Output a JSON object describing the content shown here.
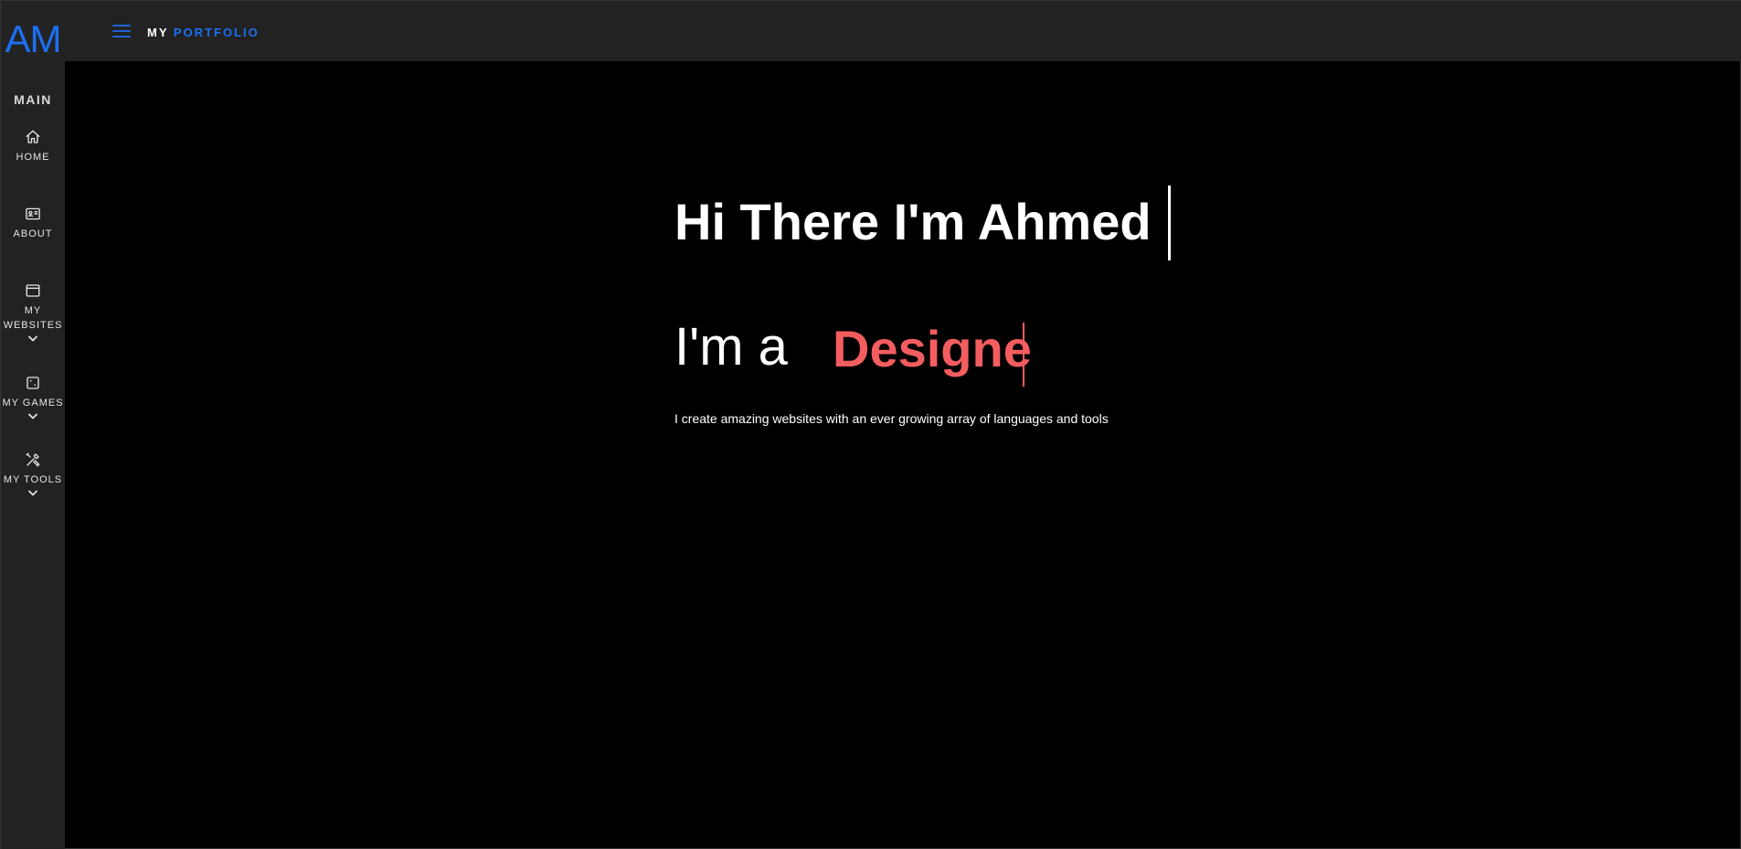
{
  "sidebar": {
    "logo": "AM",
    "section_title": "MAIN",
    "items": [
      {
        "label": "HOME",
        "icon": "home-icon",
        "has_submenu": false
      },
      {
        "label": "ABOUT",
        "icon": "id-card-icon",
        "has_submenu": false
      },
      {
        "label": "MY WEBSITES",
        "icon": "browser-window-icon",
        "has_submenu": true
      },
      {
        "label": "MY GAMES",
        "icon": "dice-icon",
        "has_submenu": true
      },
      {
        "label": "MY TOOLS",
        "icon": "tools-icon",
        "has_submenu": true
      }
    ]
  },
  "header": {
    "menu_icon": "hamburger-menu-icon",
    "brand_prefix": "MY",
    "brand_accent": "PORTFOLIO"
  },
  "hero": {
    "title": "Hi There I'm Ahmed",
    "subtitle_prefix": "I'm a",
    "subtitle_role": "Designe",
    "description": "I create amazing websites with an ever growing array of languages and tools"
  },
  "colors": {
    "accent_blue": "#1d6ff2",
    "accent_red": "#f35d5f",
    "sidebar_bg": "#222222",
    "page_bg": "#000000"
  }
}
